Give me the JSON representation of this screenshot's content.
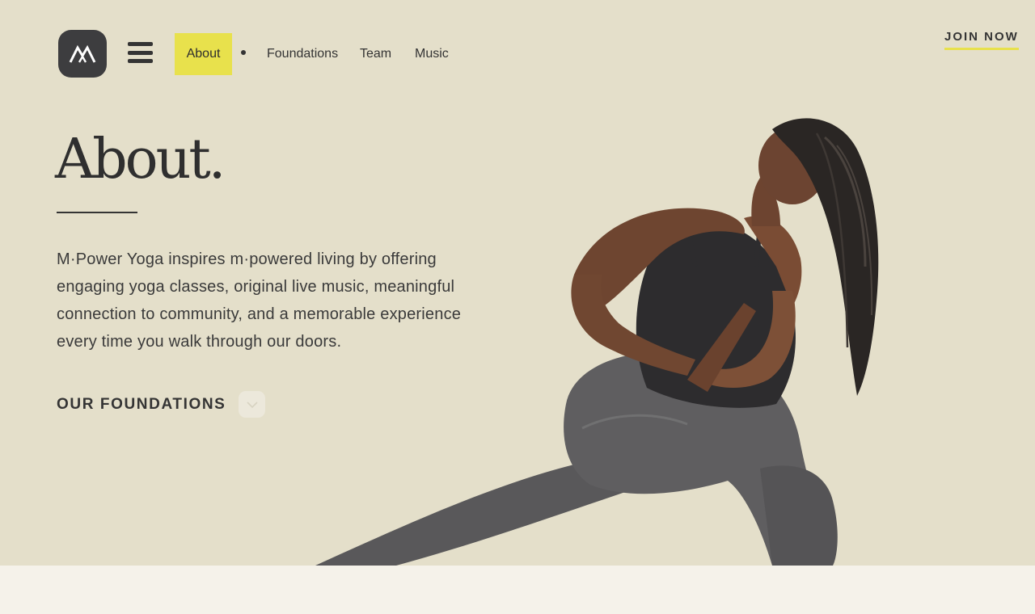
{
  "header": {
    "logo_icon": "mountain-m-logo-icon",
    "menu_icon": "hamburger-icon",
    "nav": {
      "active": "About",
      "links": [
        "Foundations",
        "Team",
        "Music"
      ]
    },
    "join_label": "JOIN NOW"
  },
  "main": {
    "title": "About.",
    "intro_lines": [
      "M·Power Yoga inspires m·powered living by offering",
      "engaging yoga classes, original live music, meaningful",
      "connection to community, and a memorable experience",
      "every time you walk through our doors."
    ],
    "cta_label": "OUR FOUNDATIONS",
    "cta_icon": "chevron-down-icon"
  },
  "colors": {
    "background": "#e4dfca",
    "accent": "#e8e14c",
    "text": "#343434",
    "footer": "#f5f2ea"
  }
}
